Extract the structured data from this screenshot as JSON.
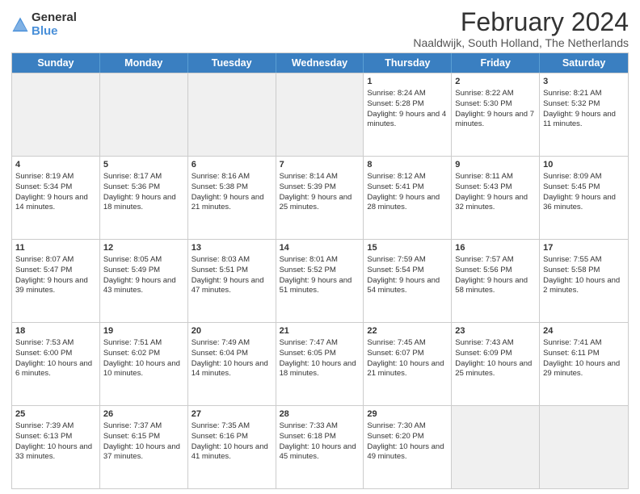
{
  "logo": {
    "general": "General",
    "blue": "Blue"
  },
  "title": "February 2024",
  "subtitle": "Naaldwijk, South Holland, The Netherlands",
  "weekdays": [
    "Sunday",
    "Monday",
    "Tuesday",
    "Wednesday",
    "Thursday",
    "Friday",
    "Saturday"
  ],
  "weeks": [
    [
      {
        "day": "",
        "info": "",
        "shaded": true
      },
      {
        "day": "",
        "info": "",
        "shaded": true
      },
      {
        "day": "",
        "info": "",
        "shaded": true
      },
      {
        "day": "",
        "info": "",
        "shaded": true
      },
      {
        "day": "1",
        "info": "Sunrise: 8:24 AM\nSunset: 5:28 PM\nDaylight: 9 hours and 4 minutes."
      },
      {
        "day": "2",
        "info": "Sunrise: 8:22 AM\nSunset: 5:30 PM\nDaylight: 9 hours and 7 minutes."
      },
      {
        "day": "3",
        "info": "Sunrise: 8:21 AM\nSunset: 5:32 PM\nDaylight: 9 hours and 11 minutes.",
        "shaded": true
      }
    ],
    [
      {
        "day": "4",
        "info": "Sunrise: 8:19 AM\nSunset: 5:34 PM\nDaylight: 9 hours and 14 minutes."
      },
      {
        "day": "5",
        "info": "Sunrise: 8:17 AM\nSunset: 5:36 PM\nDaylight: 9 hours and 18 minutes."
      },
      {
        "day": "6",
        "info": "Sunrise: 8:16 AM\nSunset: 5:38 PM\nDaylight: 9 hours and 21 minutes."
      },
      {
        "day": "7",
        "info": "Sunrise: 8:14 AM\nSunset: 5:39 PM\nDaylight: 9 hours and 25 minutes."
      },
      {
        "day": "8",
        "info": "Sunrise: 8:12 AM\nSunset: 5:41 PM\nDaylight: 9 hours and 28 minutes."
      },
      {
        "day": "9",
        "info": "Sunrise: 8:11 AM\nSunset: 5:43 PM\nDaylight: 9 hours and 32 minutes."
      },
      {
        "day": "10",
        "info": "Sunrise: 8:09 AM\nSunset: 5:45 PM\nDaylight: 9 hours and 36 minutes.",
        "shaded": true
      }
    ],
    [
      {
        "day": "11",
        "info": "Sunrise: 8:07 AM\nSunset: 5:47 PM\nDaylight: 9 hours and 39 minutes."
      },
      {
        "day": "12",
        "info": "Sunrise: 8:05 AM\nSunset: 5:49 PM\nDaylight: 9 hours and 43 minutes."
      },
      {
        "day": "13",
        "info": "Sunrise: 8:03 AM\nSunset: 5:51 PM\nDaylight: 9 hours and 47 minutes."
      },
      {
        "day": "14",
        "info": "Sunrise: 8:01 AM\nSunset: 5:52 PM\nDaylight: 9 hours and 51 minutes."
      },
      {
        "day": "15",
        "info": "Sunrise: 7:59 AM\nSunset: 5:54 PM\nDaylight: 9 hours and 54 minutes."
      },
      {
        "day": "16",
        "info": "Sunrise: 7:57 AM\nSunset: 5:56 PM\nDaylight: 9 hours and 58 minutes."
      },
      {
        "day": "17",
        "info": "Sunrise: 7:55 AM\nSunset: 5:58 PM\nDaylight: 10 hours and 2 minutes.",
        "shaded": true
      }
    ],
    [
      {
        "day": "18",
        "info": "Sunrise: 7:53 AM\nSunset: 6:00 PM\nDaylight: 10 hours and 6 minutes."
      },
      {
        "day": "19",
        "info": "Sunrise: 7:51 AM\nSunset: 6:02 PM\nDaylight: 10 hours and 10 minutes."
      },
      {
        "day": "20",
        "info": "Sunrise: 7:49 AM\nSunset: 6:04 PM\nDaylight: 10 hours and 14 minutes."
      },
      {
        "day": "21",
        "info": "Sunrise: 7:47 AM\nSunset: 6:05 PM\nDaylight: 10 hours and 18 minutes."
      },
      {
        "day": "22",
        "info": "Sunrise: 7:45 AM\nSunset: 6:07 PM\nDaylight: 10 hours and 21 minutes."
      },
      {
        "day": "23",
        "info": "Sunrise: 7:43 AM\nSunset: 6:09 PM\nDaylight: 10 hours and 25 minutes."
      },
      {
        "day": "24",
        "info": "Sunrise: 7:41 AM\nSunset: 6:11 PM\nDaylight: 10 hours and 29 minutes.",
        "shaded": true
      }
    ],
    [
      {
        "day": "25",
        "info": "Sunrise: 7:39 AM\nSunset: 6:13 PM\nDaylight: 10 hours and 33 minutes."
      },
      {
        "day": "26",
        "info": "Sunrise: 7:37 AM\nSunset: 6:15 PM\nDaylight: 10 hours and 37 minutes."
      },
      {
        "day": "27",
        "info": "Sunrise: 7:35 AM\nSunset: 6:16 PM\nDaylight: 10 hours and 41 minutes."
      },
      {
        "day": "28",
        "info": "Sunrise: 7:33 AM\nSunset: 6:18 PM\nDaylight: 10 hours and 45 minutes."
      },
      {
        "day": "29",
        "info": "Sunrise: 7:30 AM\nSunset: 6:20 PM\nDaylight: 10 hours and 49 minutes."
      },
      {
        "day": "",
        "info": "",
        "shaded": true
      },
      {
        "day": "",
        "info": "",
        "shaded": true
      }
    ]
  ]
}
